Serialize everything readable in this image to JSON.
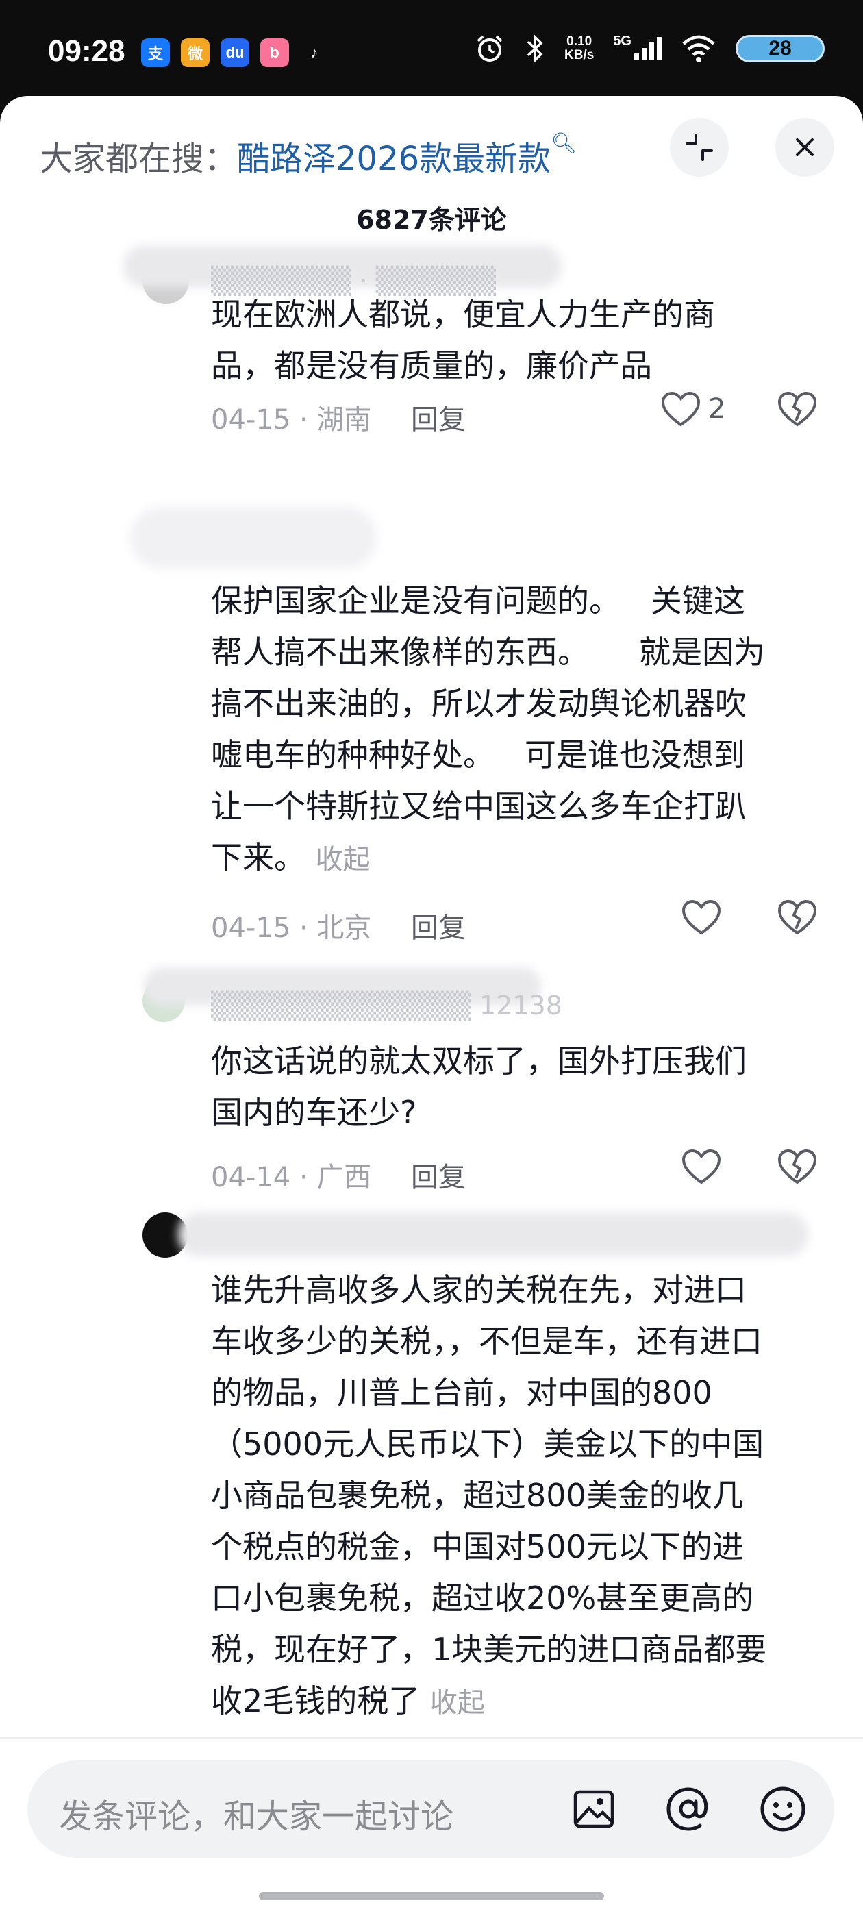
{
  "status_bar": {
    "time": "09:28",
    "app_icons": [
      {
        "name": "alipay-icon",
        "glyph": "支",
        "color": "#1677ff"
      },
      {
        "name": "weibo-icon",
        "glyph": "微",
        "color": "#f5a623"
      },
      {
        "name": "baidu-icon",
        "glyph": "du",
        "color": "#2468f2"
      },
      {
        "name": "bilibili-icon",
        "glyph": "b",
        "color": "#fb7299"
      },
      {
        "name": "douyin-icon",
        "glyph": "♪",
        "color": "#0d0d0d"
      }
    ],
    "net_speed": "0.10",
    "net_unit": "KB/s",
    "signal_label": "5G",
    "battery": "28"
  },
  "header": {
    "search_prefix": "大家都在搜：",
    "search_term": "酷路泽2026款最新款",
    "comment_count": "6827条评论"
  },
  "comments": [
    {
      "text": "现在欧洲人都说，便宜人力生产的商\n品，都是没有质量的，廉价产品",
      "date_location": "04-15 · 湖南",
      "reply_label": "回复",
      "likes": "2",
      "collapse_label": ""
    },
    {
      "text": "保护国家企业是没有问题的。   关键这\n帮人搞不出来像样的东西。     就是因为\n搞不出来油的，所以才发动舆论机器吹\n嘘电车的种种好处。   可是谁也没想到\n让一个特斯拉又给中国这么多车企打趴\n下来。",
      "date_location": "04-15 · 北京",
      "reply_label": "回复",
      "likes": "",
      "collapse_label": "收起"
    },
    {
      "text": "你这话说的就太双标了，国外打压我们\n国内的车还少?",
      "date_location": "04-14 · 广西",
      "reply_label": "回复",
      "likes": "",
      "collapse_label": ""
    },
    {
      "text": "谁先升高收多人家的关税在先，对进口\n车收多少的关税，，不但是车，还有进口\n的物品，川普上台前，对中国的800\n（5000元人民币以下）美金以下的中国\n小商品包裹免税，超过800美金的收几\n个税点的税金，中国对500元以下的进\n口小包裹免税，超过收20%甚至更高的\n税，现在好了，1块美元的进口商品都要\n收2毛钱的税了",
      "date_location": "",
      "reply_label": "",
      "likes": "",
      "collapse_label": "收起"
    }
  ],
  "input": {
    "placeholder": "发条评论，和大家一起讨论"
  },
  "colors": {
    "link_blue": "#1f5fa8",
    "muted_gray": "#a0a1a8",
    "text_dark": "#161823"
  }
}
